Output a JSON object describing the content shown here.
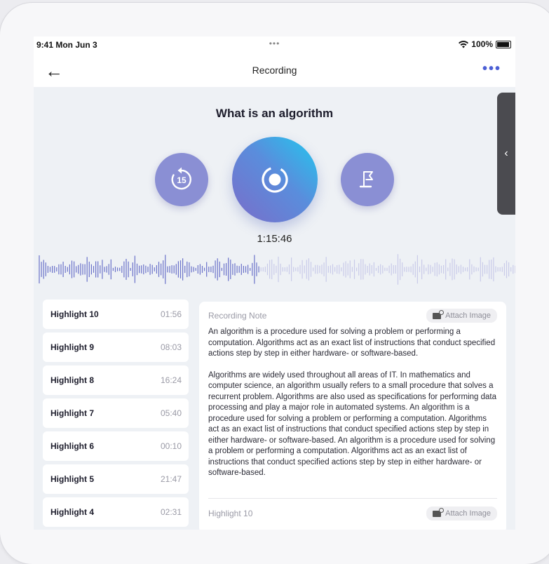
{
  "status": {
    "time": "9:41 Mon Jun 3",
    "dots": "•••",
    "battery": "100%"
  },
  "nav": {
    "back_glyph": "←",
    "title": "Recording",
    "more_glyph": "•••"
  },
  "recording": {
    "title": "What is an algorithm",
    "rewind_seconds": "15",
    "timer": "1:15:46"
  },
  "side_tab": {
    "glyph": "‹"
  },
  "highlights": [
    {
      "name": "Highlight 10",
      "time": "01:56"
    },
    {
      "name": "Highlight 9",
      "time": "08:03"
    },
    {
      "name": "Highlight 8",
      "time": "16:24"
    },
    {
      "name": "Highlight 7",
      "time": "05:40"
    },
    {
      "name": "Highlight 6",
      "time": "00:10"
    },
    {
      "name": "Highlight 5",
      "time": "21:47"
    },
    {
      "name": "Highlight 4",
      "time": "02:31"
    }
  ],
  "note": {
    "label": "Recording Note",
    "attach_label": "Attach Image",
    "paragraph1": "An algorithm is a procedure used for solving a problem or performing a computation. Algorithms act as an exact list of instructions that conduct specified actions step by step in either hardware- or software-based.",
    "paragraph2": "Algorithms are widely used throughout all areas of IT. In mathematics and computer science, an algorithm usually refers to a small procedure that solves a recurrent problem. Algorithms are also used as specifications for performing data processing and play a major role in automated systems. An algorithm is a procedure used for solving a problem or performing a computation. Algorithms act as an exact list of instructions that conduct specified actions step by step in either hardware- or software-based. An algorithm is a procedure used for solving a problem or performing a computation. Algorithms act as an exact list of instructions that conduct specified actions step by step in either hardware- or software-based."
  },
  "note2": {
    "label": "Highlight 10",
    "attach_label": "Attach Image"
  },
  "colors": {
    "accent": "#4c5fd5",
    "button": "#8a8fd4",
    "wave_active": "#6a72c9",
    "wave_inactive": "#c9cbe9"
  }
}
